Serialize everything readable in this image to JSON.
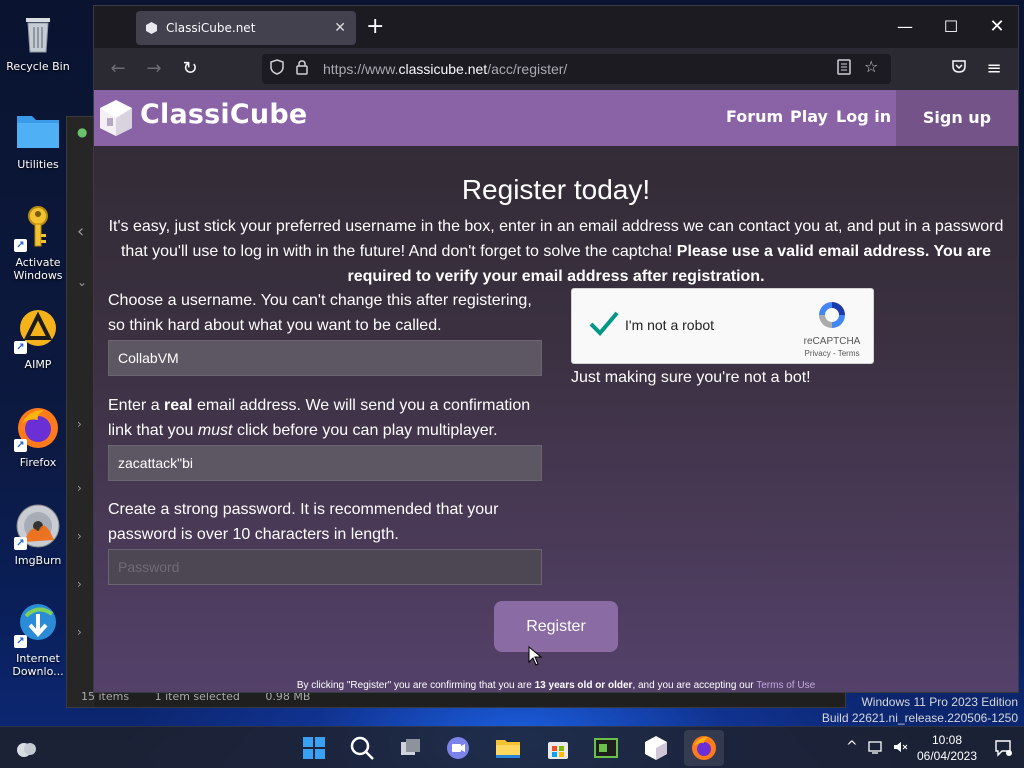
{
  "desktop": {
    "icons": [
      {
        "label": "Recycle Bin"
      },
      {
        "label": "Utilities"
      },
      {
        "label": "Activate Windows"
      },
      {
        "label": "AIMP"
      },
      {
        "label": "Firefox"
      },
      {
        "label": "ImgBurn"
      },
      {
        "label": "Internet Downlo..."
      }
    ],
    "watermark_line1": "Windows 11 Pro 2023 Edition",
    "watermark_line2": "Build 22621.ni_release.220506-1250"
  },
  "explorer": {
    "status_items": "15 items",
    "status_selected": "1 item selected",
    "status_size": "0.98 MB"
  },
  "browser": {
    "tab_title": "ClassiCube.net",
    "url_prefix": "https://www.",
    "url_domain": "classicube.net",
    "url_path": "/acc/register/"
  },
  "site": {
    "brand": "ClassiCube",
    "nav": {
      "forum": "Forum",
      "play": "Play",
      "login": "Log in",
      "signup": "Sign up"
    },
    "heading": "Register today!",
    "intro_plain": "It's easy, just stick your preferred username in the box, enter in an email address we can contact you at, and put in a password that you'll use to log in with in the future! And don't forget to solve the captcha!",
    "intro_bold": "Please use a valid email address. You are required to verify your email address after registration.",
    "username": {
      "label": "Choose a username. You can't change this after registering, so think hard about what you want to be called.",
      "value": "CollabVM"
    },
    "email": {
      "label_pre": "Enter a ",
      "label_bold": "real",
      "label_mid": " email address. We will send you a confirmation link that you ",
      "label_italic": "must",
      "label_post": " click before you can play multiplayer.",
      "value": "zacattack\"bi"
    },
    "password": {
      "label": "Create a strong password. It is recommended that your password is over 10 characters in length.",
      "placeholder": "Password"
    },
    "captcha": {
      "text": "I'm not a robot",
      "brand": "reCAPTCHA",
      "links": "Privacy - Terms",
      "checked": true
    },
    "captcha_note": "Just making sure you're not a bot!",
    "register_label": "Register",
    "footnote_pre": "By clicking \"Register\" you are confirming that you are ",
    "footnote_bold": "13 years old or older",
    "footnote_mid": ", and you are accepting our ",
    "footnote_link": "Terms of Use"
  },
  "taskbar": {
    "time": "10:08",
    "date": "06/04/2023"
  },
  "colors": {
    "header": "#8a62a6",
    "signup": "#745388",
    "register_button": "#8a6ba3",
    "captcha_check": "#009688"
  }
}
